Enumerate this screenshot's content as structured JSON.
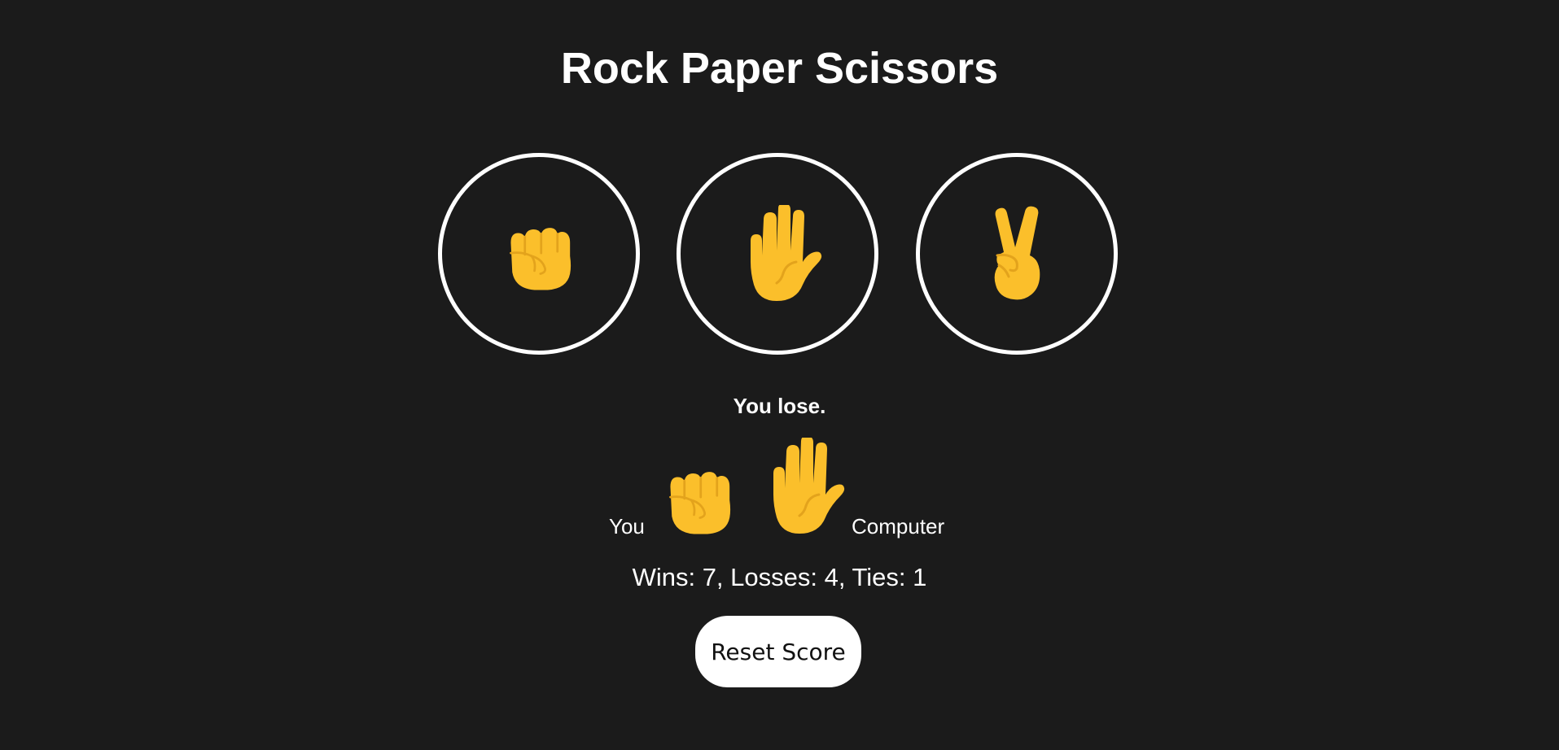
{
  "page": {
    "title": "Rock Paper Scissors"
  },
  "moves": [
    {
      "name": "rock",
      "icon": "raised-fist-icon"
    },
    {
      "name": "paper",
      "icon": "raised-hand-icon"
    },
    {
      "name": "scissors",
      "icon": "victory-hand-icon"
    }
  ],
  "result": {
    "message": "You lose.",
    "player_label": "You",
    "player_move_icon": "raised-fist-icon",
    "computer_move_icon": "raised-hand-icon",
    "computer_label": "Computer"
  },
  "score": {
    "text": "Wins: 7, Losses: 4, Ties: 1",
    "wins": 7,
    "losses": 4,
    "ties": 1
  },
  "controls": {
    "reset_label": "Reset Score"
  },
  "colors": {
    "background": "#1b1b1b",
    "text": "#ffffff",
    "emoji_fill": "#fbbf2b",
    "emoji_line": "#e3a31c"
  }
}
